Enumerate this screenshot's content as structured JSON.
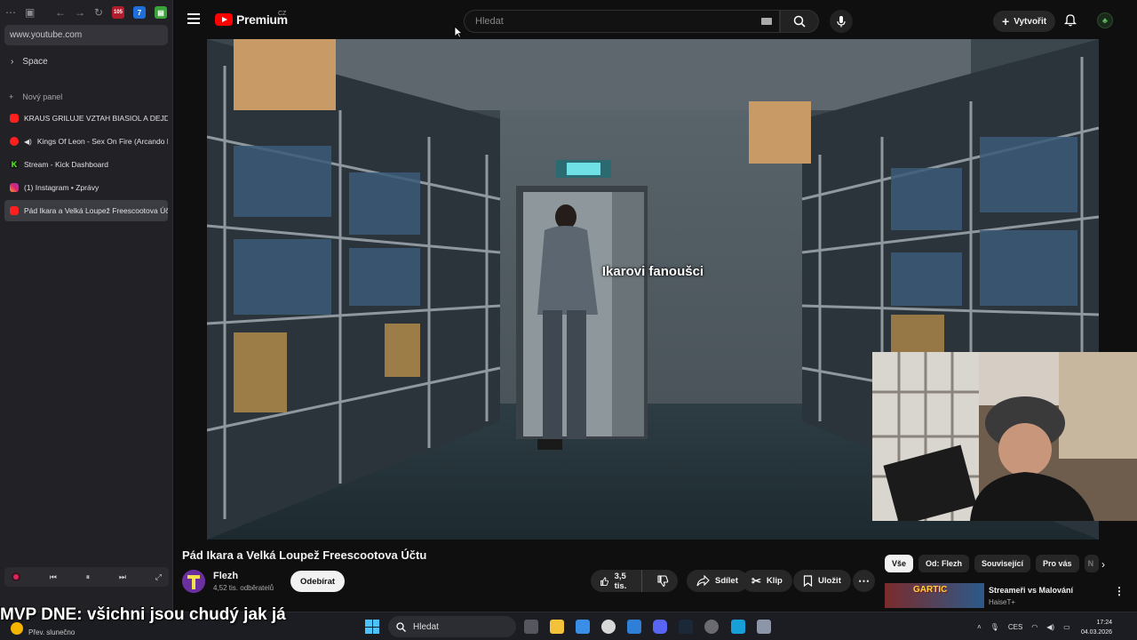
{
  "browser": {
    "url": "www.youtube.com",
    "space_label": "Space",
    "new_panel_label": "Nový panel",
    "extension_badge": "105",
    "tabs": [
      {
        "label": "KRAUS GRILUJE VZTAH BIASIOL A DEJDARA",
        "icon": "youtube-icon",
        "active": false
      },
      {
        "label": "Kings Of Leon - Sex On Fire (Arcando Re",
        "icon": "music-icon",
        "active": false
      },
      {
        "label": "Stream - Kick Dashboard",
        "icon": "kick-icon",
        "active": false
      },
      {
        "label": "(1) Instagram • Zprávy",
        "icon": "instagram-icon",
        "active": false
      },
      {
        "label": "Pád Ikara a Velká Loupež Freescootova Účtu",
        "icon": "youtube-icon",
        "active": true
      }
    ]
  },
  "youtube": {
    "logo_text": "Premium",
    "country": "CZ",
    "search_placeholder": "Hledat",
    "create_label": "Vytvořit",
    "video": {
      "caption": "Ikarovi fanoušci",
      "title": "Pád Ikara a Velká Loupež Freescootova Účtu",
      "channel": "Flezh",
      "subscribers": "4,52 tis. odběratelů",
      "subscribe_label": "Odebírat",
      "likes": "3,5 tis.",
      "share_label": "Sdílet",
      "clip_label": "Klip",
      "save_label": "Uložit"
    },
    "chips": [
      "Vše",
      "Od: Flezh",
      "Související",
      "Pro vás",
      "N"
    ],
    "recommendation": {
      "thumb_text": "GARTIC",
      "title": "Streameři vs Malování",
      "channel": "HaiseT+"
    }
  },
  "overlay_text": "MVP DNE: všichni jsou chudý jak já",
  "taskbar": {
    "weather": "Přev. slunečno",
    "search_label": "Hledat",
    "language": "CES",
    "time": "17:24",
    "date": "04.03.2026"
  },
  "colors": {
    "accent": "#ff0000",
    "background": "#0f0f0f"
  }
}
